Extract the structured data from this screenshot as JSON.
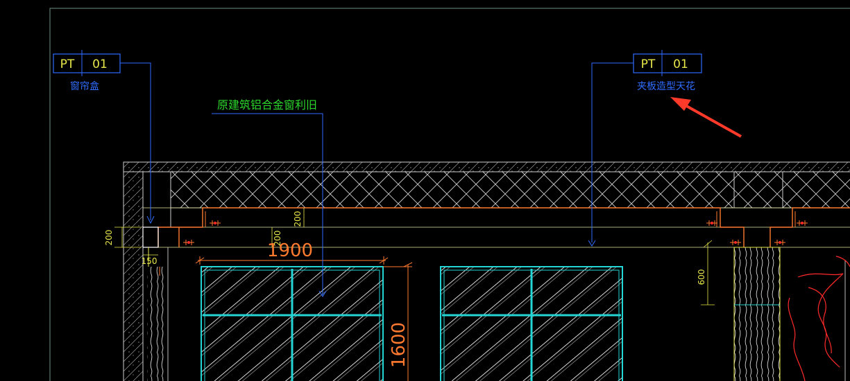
{
  "tags": [
    {
      "code": "PT",
      "num": "01",
      "caption": "窗帘盒"
    },
    {
      "code": "PT",
      "num": "01",
      "caption": "夹板造型天花"
    }
  ],
  "callout": "原建筑铝合金窗利旧",
  "dims": {
    "d200_left": "200",
    "d150": "150",
    "d200_a": "200",
    "d200_b": "200",
    "d1900": "1900",
    "d1600": "1600",
    "d600": "600"
  },
  "colors": {
    "bg": "#000000",
    "frame": "#6f8f86",
    "cyan": "#23d5d5",
    "blue": "#2f6cff",
    "orange": "#ff7a2f",
    "yellow": "#e8e84a",
    "green": "#2bd62b",
    "red": "#ff2a2a",
    "gray": "#bdbdbd",
    "red_arrow": "#ff3a2a"
  }
}
